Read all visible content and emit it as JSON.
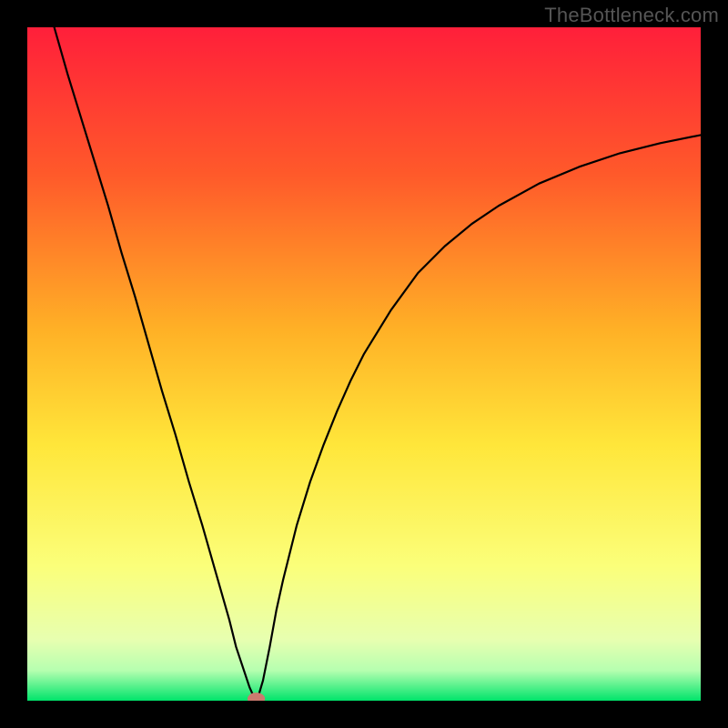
{
  "watermark": "TheBottleneck.com",
  "chart_data": {
    "type": "line",
    "title": "",
    "xlabel": "",
    "ylabel": "",
    "xlim": [
      0,
      100
    ],
    "ylim": [
      0,
      100
    ],
    "background_gradient_stops": [
      {
        "offset": 0.0,
        "color": "#ff1f3a"
      },
      {
        "offset": 0.22,
        "color": "#ff5a2a"
      },
      {
        "offset": 0.45,
        "color": "#ffb126"
      },
      {
        "offset": 0.62,
        "color": "#ffe63a"
      },
      {
        "offset": 0.8,
        "color": "#fbff7a"
      },
      {
        "offset": 0.91,
        "color": "#e7ffb0"
      },
      {
        "offset": 0.955,
        "color": "#b6ffb0"
      },
      {
        "offset": 1.0,
        "color": "#00e46b"
      }
    ],
    "series": [
      {
        "name": "curve",
        "color": "#000000",
        "stroke_width": 2.2,
        "x": [
          4.0,
          6.0,
          8.0,
          10.0,
          12.0,
          14.0,
          16.0,
          18.0,
          20.0,
          22.0,
          24.0,
          26.0,
          28.0,
          30.0,
          31.0,
          32.0,
          33.0,
          33.8,
          34.0,
          34.2,
          35.0,
          36.0,
          37.0,
          38.0,
          40.0,
          42.0,
          44.0,
          46.0,
          48.0,
          50.0,
          54.0,
          58.0,
          62.0,
          66.0,
          70.0,
          76.0,
          82.0,
          88.0,
          94.0,
          100.0
        ],
        "y": [
          100.0,
          93.0,
          86.5,
          80.0,
          73.5,
          66.5,
          60.0,
          53.0,
          46.0,
          39.5,
          32.5,
          26.0,
          19.0,
          12.0,
          8.0,
          5.0,
          2.0,
          0.2,
          0.0,
          0.3,
          3.0,
          8.0,
          13.5,
          18.0,
          26.0,
          32.5,
          38.0,
          43.0,
          47.5,
          51.5,
          58.0,
          63.5,
          67.5,
          70.8,
          73.5,
          76.8,
          79.3,
          81.3,
          82.8,
          84.0
        ]
      }
    ],
    "marker": {
      "name": "minimum-point",
      "x": 34.0,
      "y": 0.3,
      "rx": 1.3,
      "ry": 0.9,
      "color": "#cb7a6f"
    }
  }
}
